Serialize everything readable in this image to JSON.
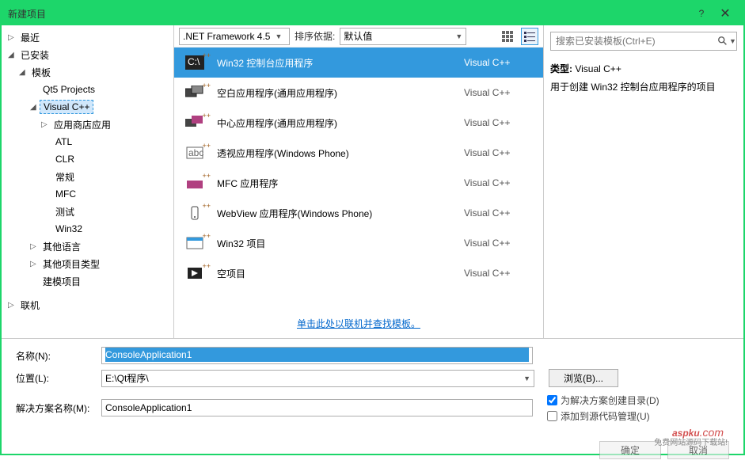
{
  "window": {
    "title": "新建项目",
    "help": "?",
    "close": "✕"
  },
  "tree": {
    "recent": "最近",
    "installed": "已安装",
    "templates": "模板",
    "qt5": "Qt5 Projects",
    "vcpp": "Visual C++",
    "store": "应用商店应用",
    "atl": "ATL",
    "clr": "CLR",
    "general": "常规",
    "mfc": "MFC",
    "test": "测试",
    "win32": "Win32",
    "otherlang": "其他语言",
    "otherproj": "其他项目类型",
    "modeling": "建模项目",
    "online": "联机"
  },
  "toolbar": {
    "framework": ".NET Framework 4.5",
    "sortLabel": "排序依据:",
    "sortValue": "默认值"
  },
  "templates": [
    {
      "name": "Win32 控制台应用程序",
      "lang": "Visual C++",
      "selected": true
    },
    {
      "name": "空白应用程序(通用应用程序)",
      "lang": "Visual C++"
    },
    {
      "name": "中心应用程序(通用应用程序)",
      "lang": "Visual C++"
    },
    {
      "name": "透视应用程序(Windows Phone)",
      "lang": "Visual C++"
    },
    {
      "name": "MFC 应用程序",
      "lang": "Visual C++"
    },
    {
      "name": "WebView 应用程序(Windows Phone)",
      "lang": "Visual C++"
    },
    {
      "name": "Win32 项目",
      "lang": "Visual C++"
    },
    {
      "name": "空项目",
      "lang": "Visual C++"
    }
  ],
  "centerFooter": {
    "link": "单击此处以联机并查找模板。"
  },
  "right": {
    "searchPlaceholder": "搜索已安装模板(Ctrl+E)",
    "typeLabel": "类型:",
    "typeValue": "Visual C++",
    "desc": "用于创建 Win32 控制台应用程序的项目"
  },
  "form": {
    "nameLabel": "名称(N):",
    "nameValue": "ConsoleApplication1",
    "locLabel": "位置(L):",
    "locValue": "E:\\Qt程序\\",
    "browse": "浏览(B)...",
    "solLabel": "解决方案名称(M):",
    "solValue": "ConsoleApplication1",
    "chk1": "为解决方案创建目录(D)",
    "chk2": "添加到源代码管理(U)"
  },
  "buttons": {
    "ok": "确定",
    "cancel": "取消"
  },
  "watermark": {
    "logo": "aspku",
    "suffix": ".com",
    "tag": "免费网站源码下载站!"
  }
}
